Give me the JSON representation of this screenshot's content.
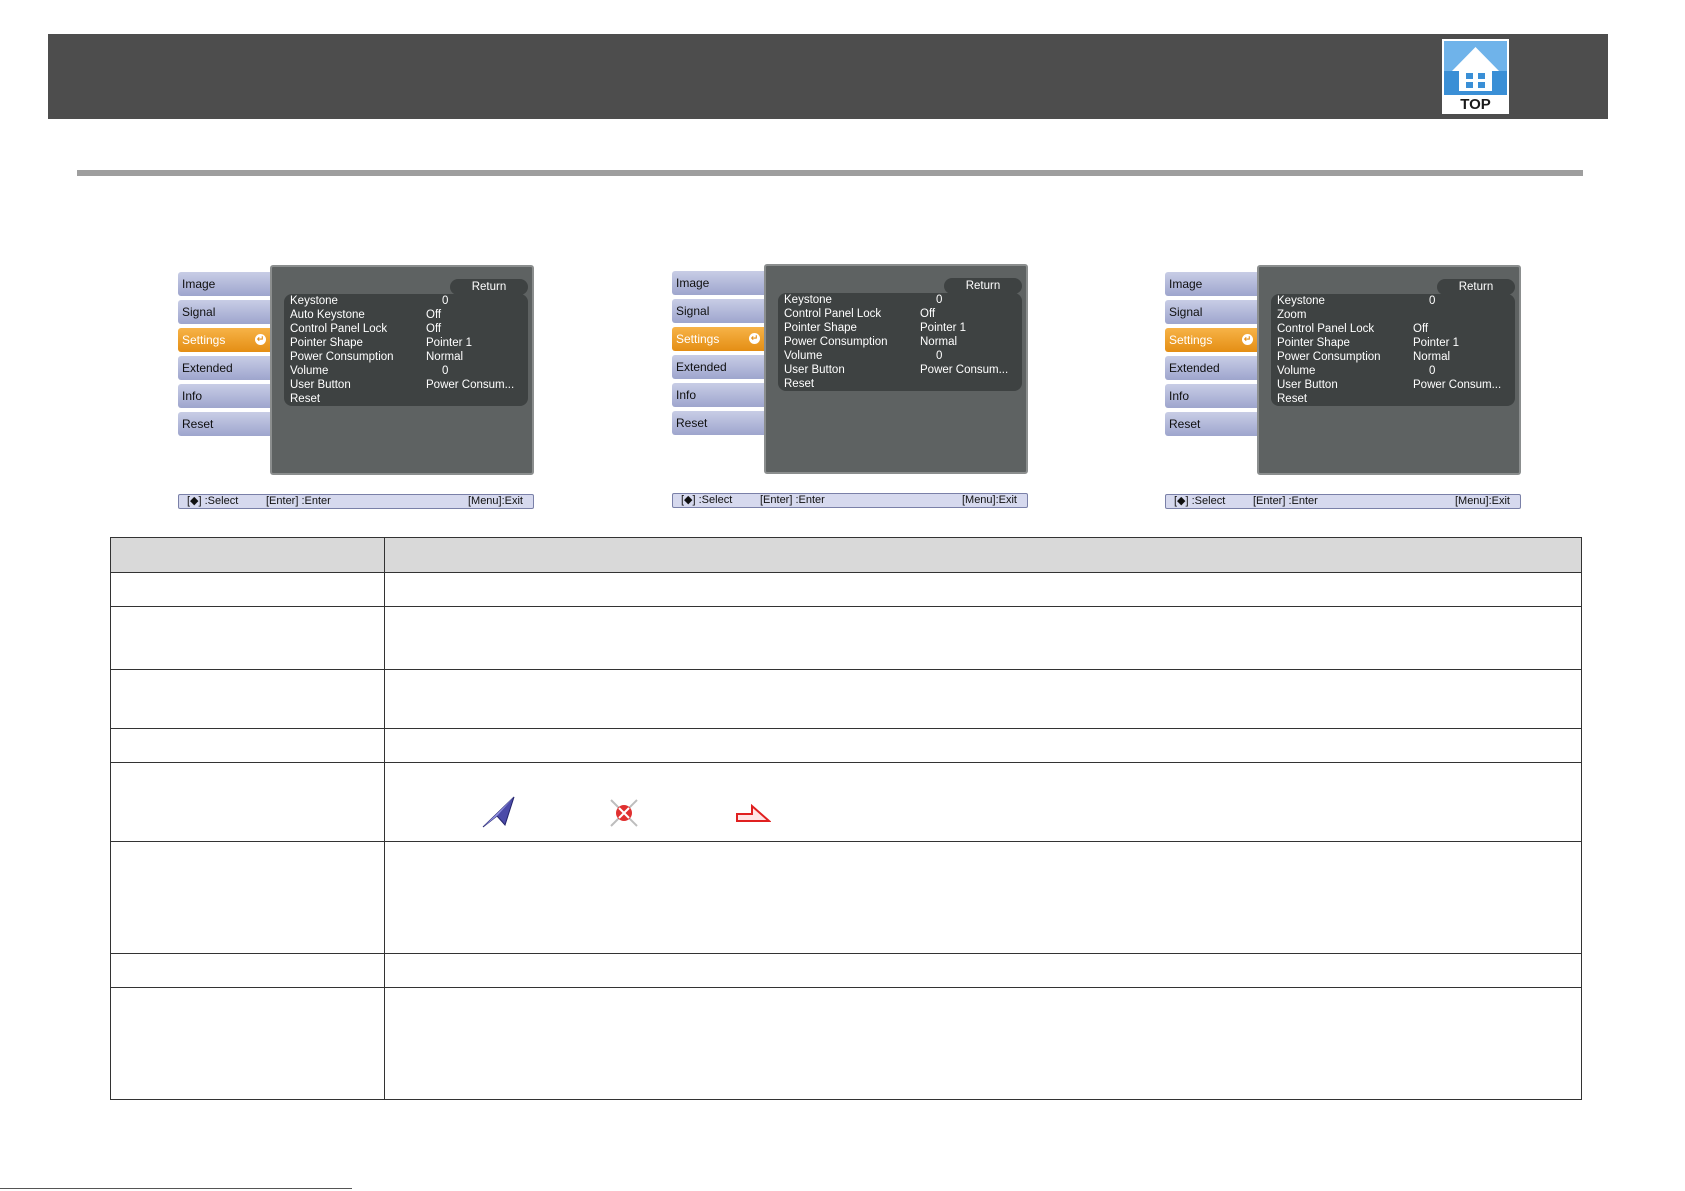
{
  "header": {
    "top_logo_label": "TOP",
    "colors": {
      "bar": "#4d4d4d",
      "logo": "#3a8fd6",
      "rule": "#9e9e9e"
    }
  },
  "menus": [
    {
      "tabs": [
        "Image",
        "Signal",
        "Settings",
        "Extended",
        "Info",
        "Reset"
      ],
      "active_tab": "Settings",
      "return_label": "Return",
      "items": [
        {
          "label": "Keystone",
          "value": "0"
        },
        {
          "label": "Auto Keystone",
          "value": "Off"
        },
        {
          "label": "Control Panel Lock",
          "value": "Off"
        },
        {
          "label": "Pointer Shape",
          "value": "Pointer 1"
        },
        {
          "label": "Power Consumption",
          "value": "Normal"
        },
        {
          "label": "Volume",
          "value": "0"
        },
        {
          "label": "User Button",
          "value": "Power Consum..."
        },
        {
          "label": "Reset",
          "value": ""
        }
      ],
      "hint_select": "[◆] :Select",
      "hint_enter": "[Enter] :Enter",
      "hint_exit": "[Menu]:Exit"
    },
    {
      "tabs": [
        "Image",
        "Signal",
        "Settings",
        "Extended",
        "Info",
        "Reset"
      ],
      "active_tab": "Settings",
      "return_label": "Return",
      "items": [
        {
          "label": "Keystone",
          "value": "0"
        },
        {
          "label": "Control Panel Lock",
          "value": "Off"
        },
        {
          "label": "Pointer Shape",
          "value": "Pointer 1"
        },
        {
          "label": "Power Consumption",
          "value": "Normal"
        },
        {
          "label": "Volume",
          "value": "0"
        },
        {
          "label": "User Button",
          "value": "Power Consum..."
        },
        {
          "label": "Reset",
          "value": ""
        }
      ],
      "hint_select": "[◆] :Select",
      "hint_enter": "[Enter] :Enter",
      "hint_exit": "[Menu]:Exit"
    },
    {
      "tabs": [
        "Image",
        "Signal",
        "Settings",
        "Extended",
        "Info",
        "Reset"
      ],
      "active_tab": "Settings",
      "return_label": "Return",
      "items": [
        {
          "label": "Keystone",
          "value": "0"
        },
        {
          "label": "Zoom",
          "value": ""
        },
        {
          "label": "Control Panel Lock",
          "value": "Off"
        },
        {
          "label": "Pointer Shape",
          "value": "Pointer 1"
        },
        {
          "label": "Power Consumption",
          "value": "Normal"
        },
        {
          "label": "Volume",
          "value": "0"
        },
        {
          "label": "User Button",
          "value": "Power Consum..."
        },
        {
          "label": "Reset",
          "value": ""
        }
      ],
      "hint_select": "[◆] :Select",
      "hint_enter": "[Enter] :Enter",
      "hint_exit": "[Menu]:Exit"
    }
  ],
  "menu_colors": {
    "panel": "#5e6262",
    "row": "#3e4242",
    "tab": "#b4badb",
    "tab_active": "#f0a030",
    "hint_bar": "#d6d9ee"
  },
  "table": {
    "header_color": "#d9d9d9",
    "pointer_icons": [
      "pointer-1-arrow-icon",
      "pointer-2-x-icon",
      "pointer-3-hand-icon"
    ]
  }
}
